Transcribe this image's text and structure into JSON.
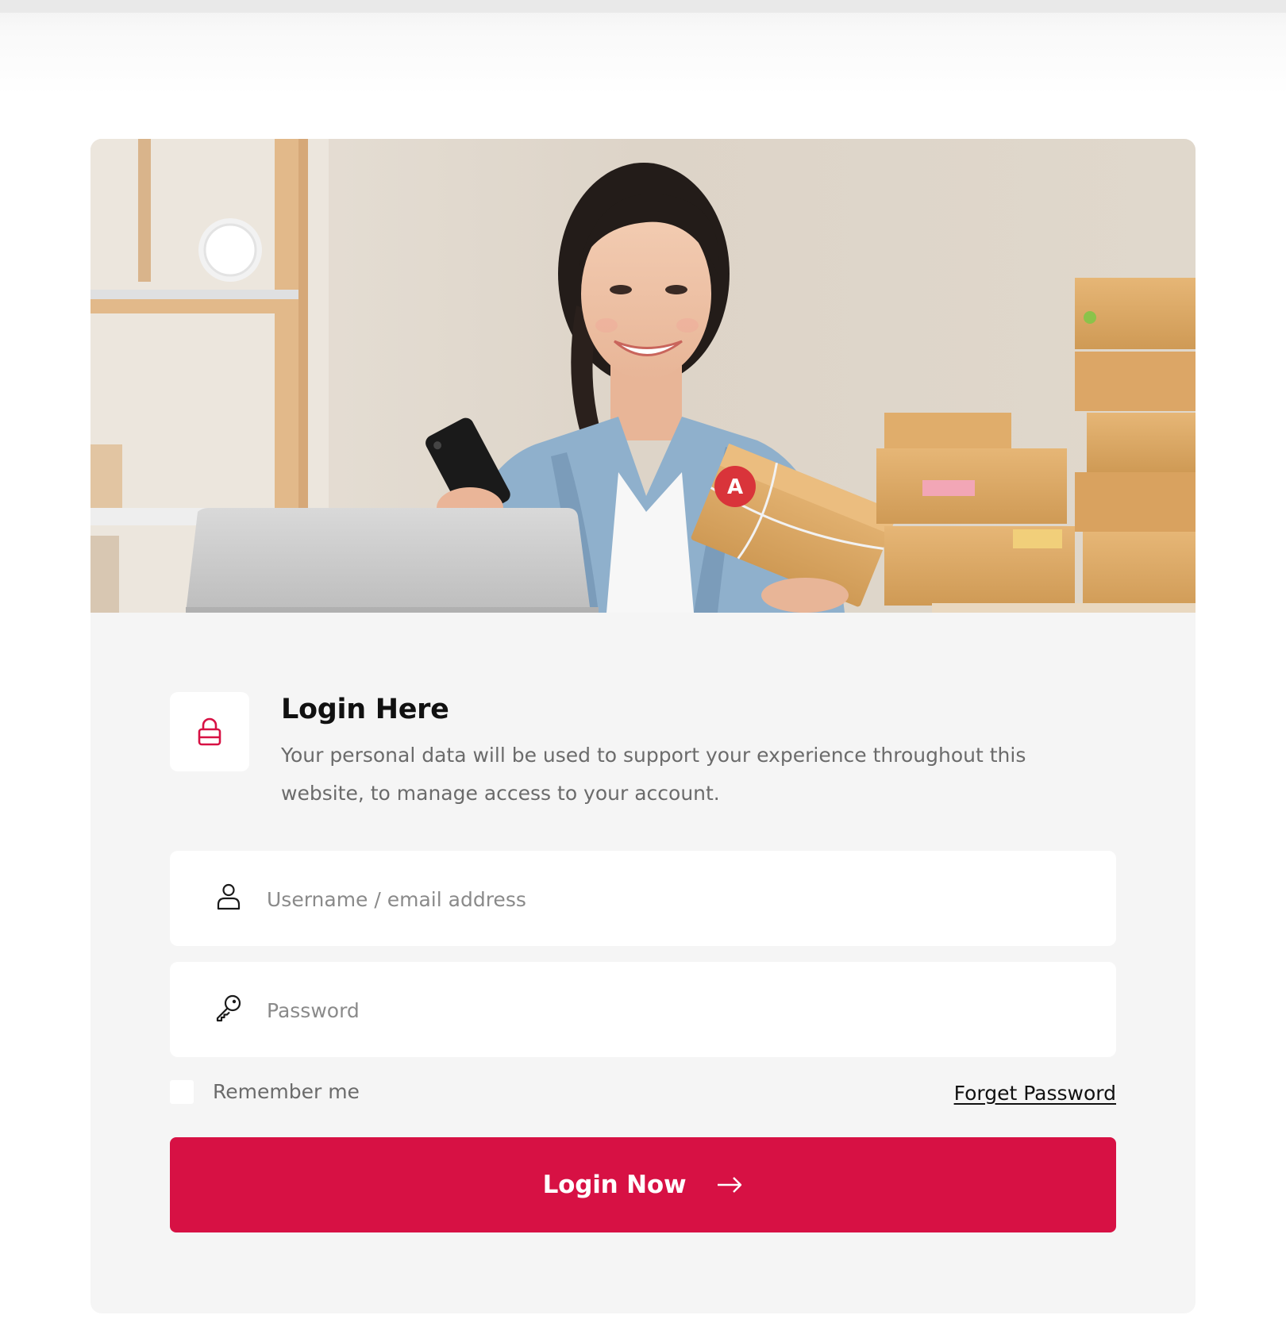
{
  "colors": {
    "accent": "#d71144",
    "card_background": "#f5f5f5",
    "field_background": "#ffffff"
  },
  "hero": {
    "icon": "photo-woman-with-phone-and-package"
  },
  "login": {
    "icon": "lock-icon",
    "title": "Login Here",
    "description": "Your personal data will be used to support your experience throughout this website, to manage access to your account."
  },
  "form": {
    "username": {
      "icon": "user-icon",
      "placeholder": "Username / email address",
      "value": ""
    },
    "password": {
      "icon": "key-icon",
      "placeholder": "Password",
      "value": ""
    },
    "remember_label": "Remember me",
    "remember_checked": false,
    "forget_label": "Forget Password",
    "submit_label": "Login Now",
    "submit_icon": "arrow-right-icon"
  }
}
